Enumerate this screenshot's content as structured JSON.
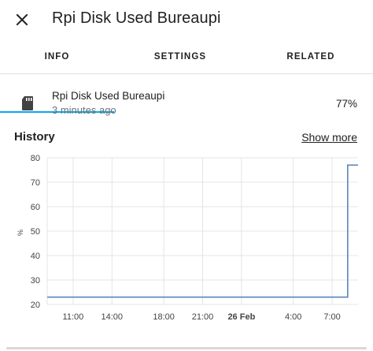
{
  "header": {
    "title": "Rpi Disk Used Bureaupi",
    "close_icon": "close-icon"
  },
  "tabs": [
    {
      "label": "INFO",
      "active": true
    },
    {
      "label": "SETTINGS",
      "active": false
    },
    {
      "label": "RELATED",
      "active": false
    }
  ],
  "entity": {
    "icon": "sd-card-icon",
    "name": "Rpi Disk Used Bureaupi",
    "last_changed": "3 minutes ago",
    "state": "77%"
  },
  "history": {
    "title": "History",
    "show_more": "Show more"
  },
  "colors": {
    "accent": "#03a9f4",
    "line": "#5b86b8",
    "grid": "#e4e4e4"
  },
  "chart_data": {
    "type": "line",
    "ylabel": "%",
    "ylim": [
      20,
      80
    ],
    "yticks": [
      "80",
      "70",
      "60",
      "50",
      "40",
      "30",
      "20"
    ],
    "xticks": [
      {
        "label": "11:00",
        "bold": false
      },
      {
        "label": "14:00",
        "bold": false
      },
      {
        "label": "18:00",
        "bold": false
      },
      {
        "label": "21:00",
        "bold": false
      },
      {
        "label": "26 Feb",
        "bold": true
      },
      {
        "label": "4:00",
        "bold": false
      },
      {
        "label": "7:00",
        "bold": false
      }
    ],
    "xrange_hours": [
      0,
      24
    ],
    "xtick_hours": [
      2,
      5,
      9,
      12,
      15,
      19,
      22
    ],
    "series": [
      {
        "x": [
          0,
          23.2,
          23.2,
          24
        ],
        "y": [
          23,
          23,
          77,
          77
        ]
      }
    ]
  }
}
